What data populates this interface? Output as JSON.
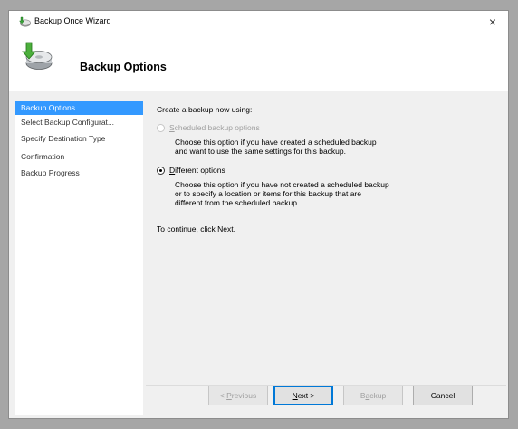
{
  "window": {
    "title": "Backup Once Wizard",
    "close_glyph": "×",
    "icon": "backup-wizard-icon"
  },
  "header": {
    "title": "Backup Options",
    "icon": "backup-disk-icon"
  },
  "sidebar": {
    "items": [
      {
        "label": "Backup Options",
        "selected": true
      },
      {
        "label": "Select Backup Configurat...",
        "selected": false
      },
      {
        "label": "Specify Destination Type",
        "selected": false
      },
      {
        "label": "Confirmation",
        "selected": false
      },
      {
        "label": "Backup Progress",
        "selected": false
      }
    ]
  },
  "main": {
    "prompt": "Create a backup now using:",
    "option_scheduled": {
      "label_first": "S",
      "label_rest": "cheduled backup options",
      "desc_line1": "Choose this option if you have created a scheduled backup",
      "desc_line2": "and want to use the same settings for this backup.",
      "enabled": false,
      "checked": false
    },
    "option_different": {
      "label_first": "D",
      "label_rest": "ifferent options",
      "desc_line1": "Choose this option if you have not created a scheduled backup",
      "desc_line2": "or to specify a location or items for this backup that are",
      "desc_line3": "different from the scheduled backup.",
      "enabled": true,
      "checked": true
    },
    "continue_text": "To continue, click Next."
  },
  "buttons": {
    "previous": {
      "pre": "< ",
      "u": "P",
      "post": "revious"
    },
    "next": {
      "u": "N",
      "post": "ext >"
    },
    "backup": {
      "pre": "B",
      "u": "a",
      "post": "ckup"
    },
    "cancel": "Cancel"
  }
}
